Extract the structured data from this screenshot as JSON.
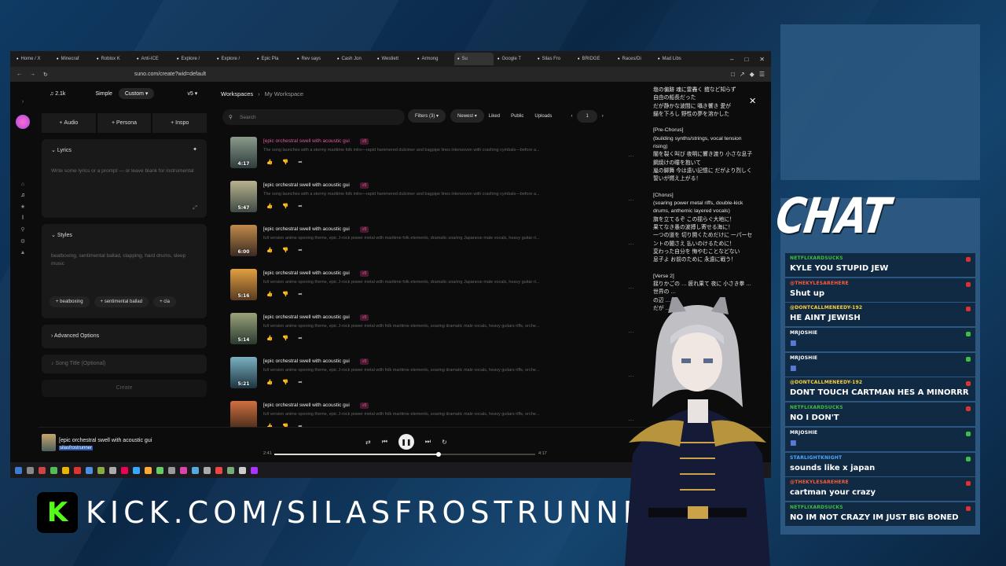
{
  "browser": {
    "tabs": [
      "Home / X",
      "Minecraf",
      "Roblox K",
      "Anti-ICE",
      "Explore /",
      "Explore /",
      "Epic Pla",
      "Rev says",
      "Cash Jon",
      "Westlett",
      "Armong",
      "Su",
      "Google T",
      "Silas Fro",
      "BRIDGE",
      "Races/Di",
      "Mad Libs"
    ],
    "url": "suno.com/create?wid=default"
  },
  "suno": {
    "credits": "2.1k",
    "mode_simple": "Simple",
    "mode_custom": "Custom",
    "version": "v5",
    "add_audio": "Audio",
    "add_persona": "Persona",
    "add_inspo": "Inspo",
    "lyrics_label": "Lyrics",
    "lyrics_placeholder": "Write some lyrics or a prompt — or leave blank for instrumental",
    "styles_label": "Styles",
    "styles_text": "beatboxing, sentimental ballad, clapping, hard drums, sleep music",
    "chips": [
      "beatboxing",
      "sentimental ballad",
      "cla"
    ],
    "advanced": "Advanced Options",
    "song_title_placeholder": "Song Title (Optional)",
    "create": "Create",
    "ws_label": "Workspaces",
    "ws_sub": "My Workspace",
    "search_placeholder": "Search",
    "filters": "Filters (3)",
    "sort": "Newest",
    "liked": "Liked",
    "public": "Public",
    "uploads": "Uploads",
    "page": "1",
    "songs": [
      {
        "title": "[epic orchestral swell with acoustic gui",
        "tag": "v5",
        "desc": "The song launches with a stormy maritime folk intro—rapid hammered dulcimer and bagpipe lines interwoven with crashing cymbals—before a...",
        "dur": "4:17",
        "hl": true,
        "c1": "#8a9a8a",
        "c2": "#2e3b3b"
      },
      {
        "title": "[epic orchestral swell with acoustic gui",
        "tag": "v5",
        "desc": "The song launches with a stormy maritime folk intro—rapid hammered dulcimer and bagpipe lines interwoven with crashing cymbals—before a...",
        "dur": "5:47",
        "hl": false,
        "c1": "#b8b28e",
        "c2": "#3e4a44"
      },
      {
        "title": "[epic orchestral swell with acoustic gui",
        "tag": "v5",
        "desc": "full version anime opening theme, epic J-rock power metal with maritime folk elements, dramatic soaring Japanese male vocals, heavy guitar ri...",
        "dur": "6:00",
        "hl": false,
        "c1": "#c08a4a",
        "c2": "#3b2a22"
      },
      {
        "title": "[epic orchestral swell with acoustic gui",
        "tag": "v5",
        "desc": "full version anime opening theme, epic J-rock power metal with maritime folk elements, dramatic soaring Japanese male vocals, heavy guitar ri...",
        "dur": "5:16",
        "hl": false,
        "c1": "#e0a040",
        "c2": "#5a3a20"
      },
      {
        "title": "[epic orchestral swell with acoustic gui",
        "tag": "v5",
        "desc": "full version anime opening theme, epic J-rock power metal with folk maritime elements, soaring dramatic male vocals, heavy guitars riffs, orche...",
        "dur": "5:14",
        "hl": false,
        "c1": "#9aa27a",
        "c2": "#2a3a30"
      },
      {
        "title": "[epic orchestral swell with acoustic gui",
        "tag": "v5",
        "desc": "full version anime opening theme, epic J-rock power metal with folk maritime elements, soaring dramatic male vocals, heavy guitars riffs, orche...",
        "dur": "5:21",
        "hl": false,
        "c1": "#7ab0c0",
        "c2": "#1e3440"
      },
      {
        "title": "[epic orchestral swell with acoustic gui",
        "tag": "v5",
        "desc": "full version anime opening theme, epic J-rock power metal with folk maritime elements, soaring dramatic male vocals, heavy guitars riffs, orche...",
        "dur": "",
        "hl": false,
        "c1": "#d07040",
        "c2": "#3a2418"
      }
    ],
    "lyrics": "塩の偏跡 魂に雷轟く 鎧など知らず\n自由の船長だった\nだが静かな波間に 囁き響き 愛が\n錨を下ろし 野性の夢を溶かした\n\n[Pre-Chorus]\n(building synths/strings, vocal tension rising)\n闇を裂く叫び 夜明に響き渡り 小さな息子 鋼焼けの瞳を抱いて\n嵐の脚舞 今は遠い記憶に だがより烈しく 誓いが燃え上がる！\n\n[Chorus]\n(soaring power metal riffs, double-kick drums, anthemic layered vocals)\n旗を立てるぞ この揺らぐ大地に！\n果てなき愚の波搏し寄せる海に！\n一つの道を 切り開くためだけに 一パーセントの闇さえ 払いのけるために！\n変わった自分を 悔やむことなどない\n息子よ お前のために 永遠に戦う！\n\n[Verse 2]\n揺りかごの … 疲れ果て 夜に 小さき拳 …\n世界の …\nの辺 …\nだが …\n",
    "player": {
      "title": "[epic orchestral swell with acoustic gui",
      "artist": "silasfrostrunner",
      "elapsed": "2:41",
      "total": "4:17",
      "progress": 0.63
    }
  },
  "overlay": {
    "chat_title": "CHAT",
    "kick_url": "KICK.COM/SILASFROSTRUNNER",
    "kick_logo": "K",
    "messages": [
      {
        "user": "NETFLIXARDSUCKS",
        "text": "KYLE YOU STUPID JEW",
        "ucolor": "#3fbf3f",
        "badge": "#e03030"
      },
      {
        "user": "@THEKYLESAREHERE",
        "text": "Shut up",
        "ucolor": "#ff5a3a",
        "badge": "#e03030"
      },
      {
        "user": "@DONTCALLMENEEDY-192",
        "text": "HE AINT JEWISH",
        "ucolor": "#ffd23a",
        "badge": "#e03030"
      },
      {
        "user": "MRJOSHIE",
        "text": "",
        "ucolor": "#ffffff",
        "badge": "#3fbf3f"
      },
      {
        "user": "MRJOSHIE",
        "text": "",
        "ucolor": "#ffffff",
        "badge": "#3fbf3f"
      },
      {
        "user": "@DONTCALLMENEEDY-192",
        "text": "DONT TOUCH CARTMAN HES A MINORRR",
        "ucolor": "#ffd23a",
        "badge": "#e03030"
      },
      {
        "user": "NETFLIXARDSUCKS",
        "text": "NO I DON'T",
        "ucolor": "#3fbf3f",
        "badge": "#e03030"
      },
      {
        "user": "MRJOSHIE",
        "text": "",
        "ucolor": "#ffffff",
        "badge": "#3fbf3f"
      },
      {
        "user": "STARLIGHTKNIGHT",
        "text": "sounds like x japan",
        "ucolor": "#4fa8ff",
        "badge": "#3fbf3f"
      },
      {
        "user": "@THEKYLESAREHERE",
        "text": "cartman your crazy",
        "ucolor": "#ff5a3a",
        "badge": "#e03030"
      },
      {
        "user": "NETFLIXARDSUCKS",
        "text": "NO IM NOT CRAZY IM JUST BIG BONED",
        "ucolor": "#3fbf3f",
        "badge": "#e03030"
      }
    ]
  }
}
